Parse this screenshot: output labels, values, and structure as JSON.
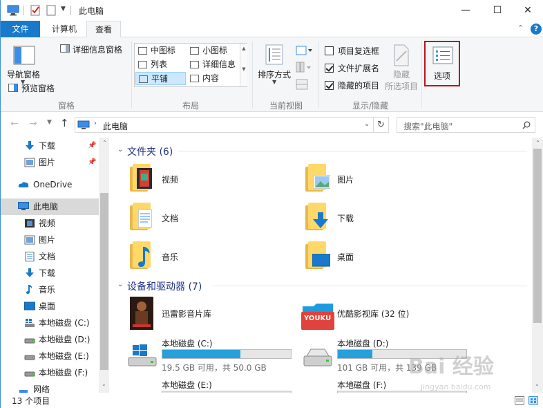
{
  "window": {
    "title": "此电脑",
    "controls": {
      "minimize": "—",
      "maximize": "☐",
      "close": "✕"
    }
  },
  "ribbon_tabs": [
    {
      "label": "文件"
    },
    {
      "label": "计算机"
    },
    {
      "label": "查看"
    }
  ],
  "ribbon": {
    "panes": {
      "nav_pane": "导航窗格",
      "preview_pane": "预览窗格",
      "details_pane": "详细信息窗格",
      "group_label": "窗格"
    },
    "layout": {
      "items": [
        "中图标",
        "小图标",
        "列表",
        "详细信息",
        "平铺",
        "内容"
      ],
      "group_label": "布局"
    },
    "current_view": {
      "sort_by": "排序方式",
      "group_label": "当前视图"
    },
    "show_hide": {
      "item_checkboxes": "项目复选框",
      "file_extensions": "文件扩展名",
      "hidden_items": "隐藏的项目",
      "hide": "隐藏",
      "hide_selected": "所选项目",
      "group_label": "显示/隐藏"
    },
    "options": {
      "label": "选项"
    },
    "help": "?"
  },
  "address": {
    "location": "此电脑",
    "search_placeholder": "搜索\"此电脑\""
  },
  "nav_pane": {
    "items": [
      {
        "label": "下载"
      },
      {
        "label": "图片"
      },
      {
        "label": "OneDrive"
      },
      {
        "label": "此电脑"
      },
      {
        "label": "视频"
      },
      {
        "label": "图片"
      },
      {
        "label": "文档"
      },
      {
        "label": "下载"
      },
      {
        "label": "音乐"
      },
      {
        "label": "桌面"
      },
      {
        "label": "本地磁盘 (C:)"
      },
      {
        "label": "本地磁盘 (D:)"
      },
      {
        "label": "本地磁盘 (E:)"
      },
      {
        "label": "本地磁盘 (F:)"
      },
      {
        "label": "网络"
      }
    ]
  },
  "content": {
    "folders_header": "文件夹 (6)",
    "folders": [
      {
        "name": "视频"
      },
      {
        "name": "图片"
      },
      {
        "name": "文档"
      },
      {
        "name": "下载"
      },
      {
        "name": "音乐"
      },
      {
        "name": "桌面"
      }
    ],
    "devices_header": "设备和驱动器 (7)",
    "devices": [
      {
        "name": "迅雷影音片库"
      },
      {
        "name": "优酷影视库 (32 位)"
      }
    ],
    "drives": [
      {
        "name": "本地磁盘 (C:)",
        "info": "19.5 GB 可用，共 50.0 GB",
        "used": 0.61
      },
      {
        "name": "本地磁盘 (D:)",
        "info": "101 GB 可用，共 139 GB",
        "used": 0.27
      },
      {
        "name": "本地磁盘 (E:)",
        "info": "",
        "used": 0.0
      },
      {
        "name": "本地磁盘 (F:)",
        "info": "",
        "used": 0.0
      }
    ],
    "youku_logo": "YOUKU"
  },
  "status": {
    "item_count": "13 个项目"
  },
  "watermark": {
    "text": "Bai 经验",
    "sub": "jingyan.baidu.com"
  },
  "colors": {
    "accent": "#1979ca",
    "folder": "#ffd86a",
    "drive_fill": "#26a0da",
    "highlight_red": "#b3161b"
  }
}
